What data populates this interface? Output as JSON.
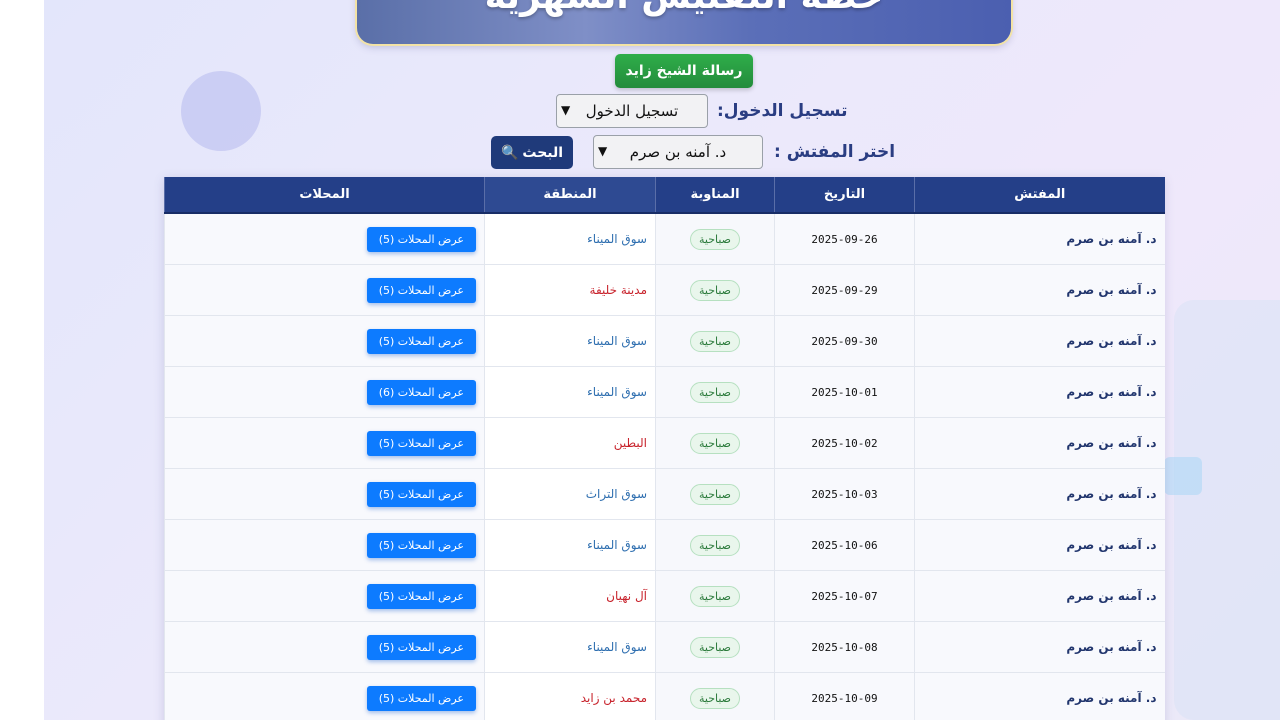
{
  "banner": {
    "title": "خطة التفتيش الشهرية"
  },
  "letter_button": {
    "label": "رسالة الشيخ زايد"
  },
  "login": {
    "label": "تسجيل الدخول:",
    "selected": "تسجيل الدخول"
  },
  "inspector_filter": {
    "label": "اختر المفتش :",
    "selected": "د. آمنه بن صرم"
  },
  "search_button": {
    "label": "البحث",
    "icon": "magnifier-icon"
  },
  "table": {
    "headers": [
      "المفتش",
      "التاريخ",
      "المناوبة",
      "المنطقة",
      "المحلات"
    ],
    "rows": [
      {
        "inspector": "د. آمنه بن صرم",
        "date": "2025-09-26",
        "shift": "صباحية",
        "region": "سوق الميناء",
        "region_color": "#2f6fb0",
        "shops": "عرض المحلات (5)"
      },
      {
        "inspector": "د. آمنه بن صرم",
        "date": "2025-09-29",
        "shift": "صباحية",
        "region": "مدينة خليفة",
        "region_color": "#c8232c",
        "shops": "عرض المحلات (5)"
      },
      {
        "inspector": "د. آمنه بن صرم",
        "date": "2025-09-30",
        "shift": "صباحية",
        "region": "سوق الميناء",
        "region_color": "#2f6fb0",
        "shops": "عرض المحلات (5)"
      },
      {
        "inspector": "د. آمنه بن صرم",
        "date": "2025-10-01",
        "shift": "صباحية",
        "region": "سوق الميناء",
        "region_color": "#2f6fb0",
        "shops": "عرض المحلات (6)"
      },
      {
        "inspector": "د. آمنه بن صرم",
        "date": "2025-10-02",
        "shift": "صباحية",
        "region": "البطين",
        "region_color": "#c8232c",
        "shops": "عرض المحلات (5)"
      },
      {
        "inspector": "د. آمنه بن صرم",
        "date": "2025-10-03",
        "shift": "صباحية",
        "region": "سوق التراث",
        "region_color": "#2f6fb0",
        "shops": "عرض المحلات (5)"
      },
      {
        "inspector": "د. آمنه بن صرم",
        "date": "2025-10-06",
        "shift": "صباحية",
        "region": "سوق الميناء",
        "region_color": "#2f6fb0",
        "shops": "عرض المحلات (5)"
      },
      {
        "inspector": "د. آمنه بن صرم",
        "date": "2025-10-07",
        "shift": "صباحية",
        "region": "آل نهيان",
        "region_color": "#c8232c",
        "shops": "عرض المحلات (5)"
      },
      {
        "inspector": "د. آمنه بن صرم",
        "date": "2025-10-08",
        "shift": "صباحية",
        "region": "سوق الميناء",
        "region_color": "#2f6fb0",
        "shops": "عرض المحلات (5)"
      },
      {
        "inspector": "د. آمنه بن صرم",
        "date": "2025-10-09",
        "shift": "صباحية",
        "region": "محمد بن زايد",
        "region_color": "#c8232c",
        "shops": "عرض المحلات (5)"
      }
    ]
  }
}
